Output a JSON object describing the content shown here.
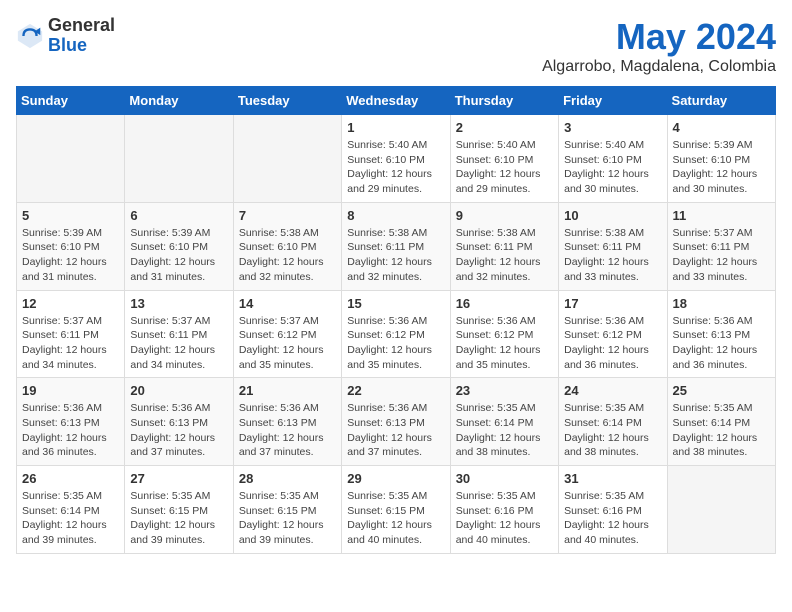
{
  "logo": {
    "general": "General",
    "blue": "Blue"
  },
  "header": {
    "month_year": "May 2024",
    "location": "Algarrobo, Magdalena, Colombia"
  },
  "weekdays": [
    "Sunday",
    "Monday",
    "Tuesday",
    "Wednesday",
    "Thursday",
    "Friday",
    "Saturday"
  ],
  "weeks": [
    [
      {
        "day": "",
        "info": ""
      },
      {
        "day": "",
        "info": ""
      },
      {
        "day": "",
        "info": ""
      },
      {
        "day": "1",
        "info": "Sunrise: 5:40 AM\nSunset: 6:10 PM\nDaylight: 12 hours\nand 29 minutes."
      },
      {
        "day": "2",
        "info": "Sunrise: 5:40 AM\nSunset: 6:10 PM\nDaylight: 12 hours\nand 29 minutes."
      },
      {
        "day": "3",
        "info": "Sunrise: 5:40 AM\nSunset: 6:10 PM\nDaylight: 12 hours\nand 30 minutes."
      },
      {
        "day": "4",
        "info": "Sunrise: 5:39 AM\nSunset: 6:10 PM\nDaylight: 12 hours\nand 30 minutes."
      }
    ],
    [
      {
        "day": "5",
        "info": "Sunrise: 5:39 AM\nSunset: 6:10 PM\nDaylight: 12 hours\nand 31 minutes."
      },
      {
        "day": "6",
        "info": "Sunrise: 5:39 AM\nSunset: 6:10 PM\nDaylight: 12 hours\nand 31 minutes."
      },
      {
        "day": "7",
        "info": "Sunrise: 5:38 AM\nSunset: 6:10 PM\nDaylight: 12 hours\nand 32 minutes."
      },
      {
        "day": "8",
        "info": "Sunrise: 5:38 AM\nSunset: 6:11 PM\nDaylight: 12 hours\nand 32 minutes."
      },
      {
        "day": "9",
        "info": "Sunrise: 5:38 AM\nSunset: 6:11 PM\nDaylight: 12 hours\nand 32 minutes."
      },
      {
        "day": "10",
        "info": "Sunrise: 5:38 AM\nSunset: 6:11 PM\nDaylight: 12 hours\nand 33 minutes."
      },
      {
        "day": "11",
        "info": "Sunrise: 5:37 AM\nSunset: 6:11 PM\nDaylight: 12 hours\nand 33 minutes."
      }
    ],
    [
      {
        "day": "12",
        "info": "Sunrise: 5:37 AM\nSunset: 6:11 PM\nDaylight: 12 hours\nand 34 minutes."
      },
      {
        "day": "13",
        "info": "Sunrise: 5:37 AM\nSunset: 6:11 PM\nDaylight: 12 hours\nand 34 minutes."
      },
      {
        "day": "14",
        "info": "Sunrise: 5:37 AM\nSunset: 6:12 PM\nDaylight: 12 hours\nand 35 minutes."
      },
      {
        "day": "15",
        "info": "Sunrise: 5:36 AM\nSunset: 6:12 PM\nDaylight: 12 hours\nand 35 minutes."
      },
      {
        "day": "16",
        "info": "Sunrise: 5:36 AM\nSunset: 6:12 PM\nDaylight: 12 hours\nand 35 minutes."
      },
      {
        "day": "17",
        "info": "Sunrise: 5:36 AM\nSunset: 6:12 PM\nDaylight: 12 hours\nand 36 minutes."
      },
      {
        "day": "18",
        "info": "Sunrise: 5:36 AM\nSunset: 6:13 PM\nDaylight: 12 hours\nand 36 minutes."
      }
    ],
    [
      {
        "day": "19",
        "info": "Sunrise: 5:36 AM\nSunset: 6:13 PM\nDaylight: 12 hours\nand 36 minutes."
      },
      {
        "day": "20",
        "info": "Sunrise: 5:36 AM\nSunset: 6:13 PM\nDaylight: 12 hours\nand 37 minutes."
      },
      {
        "day": "21",
        "info": "Sunrise: 5:36 AM\nSunset: 6:13 PM\nDaylight: 12 hours\nand 37 minutes."
      },
      {
        "day": "22",
        "info": "Sunrise: 5:36 AM\nSunset: 6:13 PM\nDaylight: 12 hours\nand 37 minutes."
      },
      {
        "day": "23",
        "info": "Sunrise: 5:35 AM\nSunset: 6:14 PM\nDaylight: 12 hours\nand 38 minutes."
      },
      {
        "day": "24",
        "info": "Sunrise: 5:35 AM\nSunset: 6:14 PM\nDaylight: 12 hours\nand 38 minutes."
      },
      {
        "day": "25",
        "info": "Sunrise: 5:35 AM\nSunset: 6:14 PM\nDaylight: 12 hours\nand 38 minutes."
      }
    ],
    [
      {
        "day": "26",
        "info": "Sunrise: 5:35 AM\nSunset: 6:14 PM\nDaylight: 12 hours\nand 39 minutes."
      },
      {
        "day": "27",
        "info": "Sunrise: 5:35 AM\nSunset: 6:15 PM\nDaylight: 12 hours\nand 39 minutes."
      },
      {
        "day": "28",
        "info": "Sunrise: 5:35 AM\nSunset: 6:15 PM\nDaylight: 12 hours\nand 39 minutes."
      },
      {
        "day": "29",
        "info": "Sunrise: 5:35 AM\nSunset: 6:15 PM\nDaylight: 12 hours\nand 40 minutes."
      },
      {
        "day": "30",
        "info": "Sunrise: 5:35 AM\nSunset: 6:16 PM\nDaylight: 12 hours\nand 40 minutes."
      },
      {
        "day": "31",
        "info": "Sunrise: 5:35 AM\nSunset: 6:16 PM\nDaylight: 12 hours\nand 40 minutes."
      },
      {
        "day": "",
        "info": ""
      }
    ]
  ]
}
